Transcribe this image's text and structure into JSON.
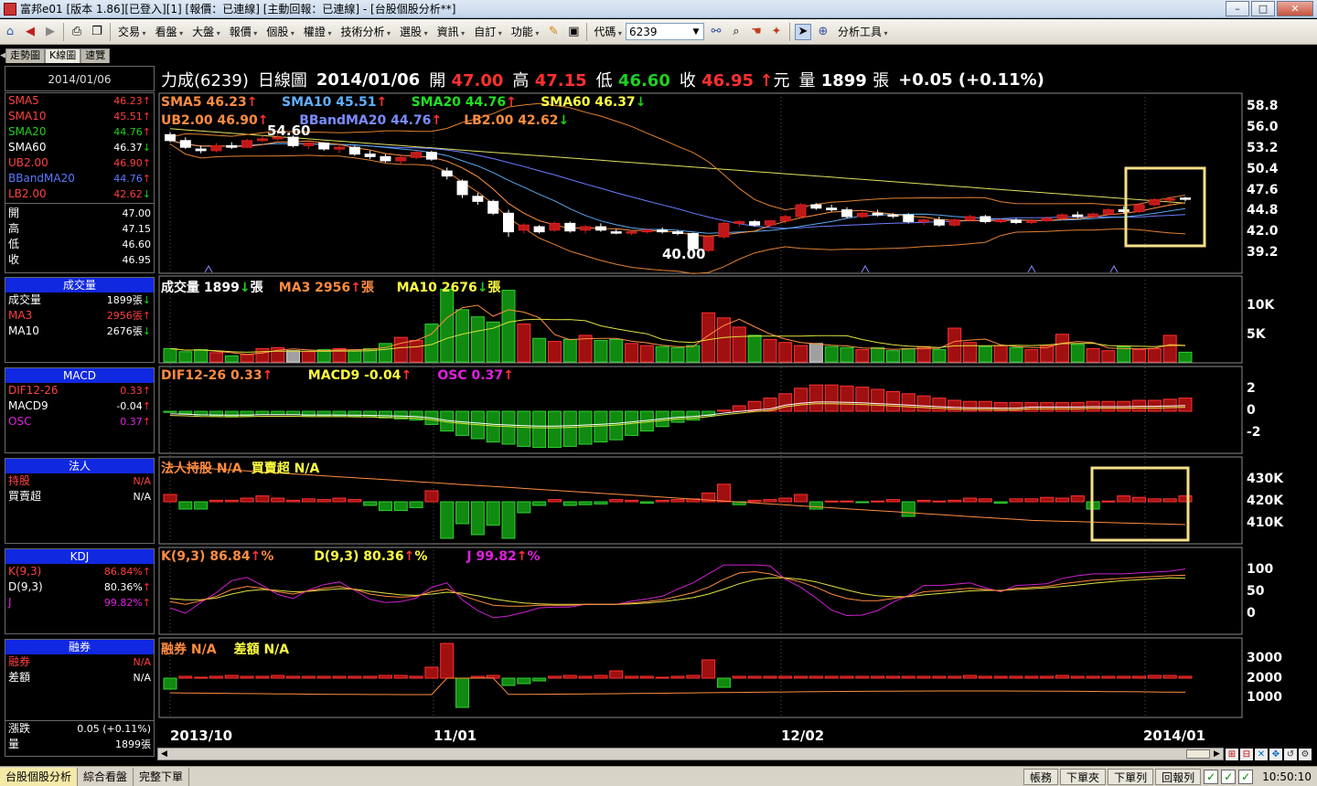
{
  "window": {
    "title": "富邦e01 [版本 1.86][已登入][1] [報價：已連線] [主動回報：已連線] - [台股個股分析**]"
  },
  "menu": {
    "items": [
      "交易",
      "看盤",
      "大盤",
      "報價",
      "個股",
      "權證",
      "技術分析",
      "選股",
      "資訊",
      "自訂",
      "功能"
    ],
    "code_label": "代碼",
    "code_value": "6239",
    "analysis_tools": "分析工具"
  },
  "tabs": [
    "走勢圖",
    "K線圖",
    "速覽"
  ],
  "header": {
    "name": "力成(6239)",
    "period": "日線圖",
    "date": "2014/01/06",
    "open_label": "開",
    "open": "47.00",
    "high_label": "高",
    "high": "47.15",
    "low_label": "低",
    "low": "46.60",
    "close_label": "收",
    "close": "46.95",
    "unit": "元",
    "vol_label": "量",
    "volume": "1899",
    "vol_unit": "張",
    "change": "+0.05 (+0.11%)"
  },
  "side": {
    "date": "2014/01/06",
    "price": [
      {
        "label": "SMA5",
        "value": "46.23",
        "dir": "up",
        "color": "#ff4040"
      },
      {
        "label": "SMA10",
        "value": "45.51",
        "dir": "up",
        "color": "#ff4040"
      },
      {
        "label": "SMA20",
        "value": "44.76",
        "dir": "up",
        "color": "#20d020"
      },
      {
        "label": "SMA60",
        "value": "46.37",
        "dir": "dn",
        "color": "#ffffff"
      },
      {
        "label": "UB2.00",
        "value": "46.90",
        "dir": "up",
        "color": "#ff4040"
      },
      {
        "label": "BBandMA20",
        "value": "44.76",
        "dir": "up",
        "color": "#5a7aff"
      },
      {
        "label": "LB2.00",
        "value": "42.62",
        "dir": "dn",
        "color": "#ff4040"
      }
    ],
    "ohlc": [
      {
        "label": "開",
        "value": "47.00"
      },
      {
        "label": "高",
        "value": "47.15"
      },
      {
        "label": "低",
        "value": "46.60"
      },
      {
        "label": "收",
        "value": "46.95"
      }
    ],
    "vol": {
      "head": "成交量",
      "rows": [
        {
          "label": "成交量",
          "value": "1899張",
          "dir": "dn",
          "color": "#ffffff"
        },
        {
          "label": "MA3",
          "value": "2956張",
          "dir": "up",
          "color": "#ff4040"
        },
        {
          "label": "MA10",
          "value": "2676張",
          "dir": "dn",
          "color": "#ffffff"
        }
      ]
    },
    "macd": {
      "head": "MACD",
      "rows": [
        {
          "label": "DIF12-26",
          "value": "0.33",
          "dir": "up",
          "color": "#ff4040"
        },
        {
          "label": "MACD9",
          "value": "-0.04",
          "dir": "up",
          "color": "#ffffff"
        },
        {
          "label": "OSC",
          "value": "0.37",
          "dir": "up",
          "color": "#e020e0"
        }
      ]
    },
    "inst": {
      "head": "法人",
      "rows": [
        {
          "label": "持股",
          "value": "N/A",
          "dir": "",
          "color": "#ff4040"
        },
        {
          "label": "買賣超",
          "value": "N/A",
          "dir": "",
          "color": "#ffffff"
        }
      ]
    },
    "kdj": {
      "head": "KDJ",
      "rows": [
        {
          "label": "K(9,3)",
          "value": "86.84%",
          "dir": "up",
          "color": "#ff4040"
        },
        {
          "label": "D(9,3)",
          "value": "80.36%",
          "dir": "up",
          "color": "#ffffff"
        },
        {
          "label": "J",
          "value": "99.82%",
          "dir": "up",
          "color": "#e020e0"
        }
      ]
    },
    "margin": {
      "head": "融券",
      "rows": [
        {
          "label": "融券",
          "value": "N/A",
          "dir": "",
          "color": "#ff4040"
        },
        {
          "label": "差額",
          "value": "N/A",
          "dir": "",
          "color": "#ffffff"
        }
      ]
    },
    "summary": [
      {
        "label": "漲跌",
        "value": "0.05 (+0.11%)"
      },
      {
        "label": "量",
        "value": "1899張"
      }
    ]
  },
  "panels": {
    "price": {
      "line1": [
        {
          "text": "SMA5 46.23",
          "dir": "up",
          "color": "#ff8c40"
        },
        {
          "text": "SMA10 45.51",
          "dir": "up",
          "color": "#60b0ff"
        },
        {
          "text": "SMA20 44.76",
          "dir": "up",
          "color": "#20e020"
        },
        {
          "text": "SMA60 46.37",
          "dir": "dn",
          "color": "#ffff40"
        }
      ],
      "line2": [
        {
          "text": "UB2.00 46.90",
          "dir": "up",
          "color": "#ff8c40"
        },
        {
          "text": "BBandMA20 44.76",
          "dir": "up",
          "color": "#7a8cff"
        },
        {
          "text": "LB2.00 42.62",
          "dir": "dn",
          "color": "#ff8c40"
        }
      ],
      "yticks": [
        "58.8",
        "56.0",
        "53.2",
        "50.4",
        "47.6",
        "44.8",
        "42.0",
        "39.2"
      ],
      "hi_label": "54.60",
      "lo_label": "40.00"
    },
    "volume": {
      "items": [
        {
          "text": "成交量 1899",
          "dir": "dn",
          "color": "#ffffff",
          "suffix": "張"
        },
        {
          "text": "MA3 2956",
          "dir": "up",
          "color": "#ff8c40",
          "suffix": "張"
        },
        {
          "text": "MA10 2676",
          "dir": "dn",
          "color": "#ffff40",
          "suffix": "張"
        }
      ],
      "yticks": [
        "10K",
        "5K"
      ]
    },
    "macd": {
      "items": [
        {
          "text": "DIF12-26 0.33",
          "dir": "up",
          "color": "#ff8c40"
        },
        {
          "text": "MACD9 -0.04",
          "dir": "up",
          "color": "#ffff40"
        },
        {
          "text": "OSC 0.37",
          "dir": "up",
          "color": "#e020e0"
        }
      ],
      "yticks": [
        "2",
        "0",
        "-2"
      ]
    },
    "inst": {
      "items": [
        {
          "text": "法人持股 N/A",
          "dir": "",
          "color": "#ff8c40"
        },
        {
          "text": "買賣超 N/A",
          "dir": "",
          "color": "#ffff40"
        }
      ],
      "yticks": [
        "430K",
        "420K",
        "410K"
      ]
    },
    "kdj": {
      "items": [
        {
          "text": "K(9,3) 86.84",
          "dir": "up",
          "color": "#ff8c40",
          "suffix": "%"
        },
        {
          "text": "D(9,3) 80.36",
          "dir": "up",
          "color": "#ffff40",
          "suffix": "%"
        },
        {
          "text": "J 99.82",
          "dir": "up",
          "color": "#e020e0",
          "suffix": "%"
        }
      ],
      "yticks": [
        "100",
        "50",
        "0"
      ]
    },
    "margin": {
      "items": [
        {
          "text": "融券 N/A",
          "dir": "",
          "color": "#ff8c40"
        },
        {
          "text": "差額 N/A",
          "dir": "",
          "color": "#ffff40"
        }
      ],
      "yticks": [
        "3000",
        "2000",
        "1000"
      ]
    }
  },
  "xaxis": [
    "2013/10",
    "11/01",
    "12/02",
    "2014/01"
  ],
  "statusbar": {
    "tabs": [
      "台股個股分析",
      "綜合看盤",
      "完整下單"
    ],
    "buttons": [
      "帳務",
      "下單夾",
      "下單列",
      "回報列"
    ],
    "clock": "10:50:10"
  },
  "chart_data": {
    "type": "candlestick",
    "note_series": "daily bars from 2013/10 to 2014/01/06 (approx. read from chart)",
    "ohlc": [
      [
        54.5,
        54.8,
        53.6,
        53.8
      ],
      [
        53.8,
        54.2,
        52.8,
        53.0
      ],
      [
        52.8,
        53.2,
        52.3,
        52.6
      ],
      [
        52.6,
        53.5,
        52.4,
        53.2
      ],
      [
        53.2,
        53.6,
        52.8,
        53.0
      ],
      [
        53.0,
        54.0,
        52.9,
        53.8
      ],
      [
        53.8,
        54.4,
        53.6,
        54.0
      ],
      [
        54.0,
        54.6,
        53.8,
        54.2
      ],
      [
        54.2,
        54.4,
        53.0,
        53.2
      ],
      [
        53.2,
        53.6,
        52.8,
        53.5
      ],
      [
        53.5,
        53.6,
        52.6,
        52.8
      ],
      [
        52.8,
        53.3,
        52.3,
        53.0
      ],
      [
        53.0,
        53.2,
        52.0,
        52.2
      ],
      [
        52.2,
        52.6,
        51.6,
        51.9
      ],
      [
        51.9,
        52.2,
        51.2,
        51.4
      ],
      [
        51.4,
        52.0,
        51.0,
        51.8
      ],
      [
        51.8,
        52.6,
        51.6,
        52.4
      ],
      [
        52.4,
        52.6,
        51.4,
        51.6
      ],
      [
        50.2,
        50.6,
        49.2,
        49.6
      ],
      [
        49.0,
        49.2,
        47.0,
        47.4
      ],
      [
        47.2,
        47.6,
        46.2,
        46.6
      ],
      [
        46.6,
        46.8,
        45.0,
        45.2
      ],
      [
        45.2,
        45.6,
        42.4,
        43.0
      ],
      [
        43.2,
        44.0,
        42.8,
        43.8
      ],
      [
        43.6,
        43.8,
        42.8,
        43.0
      ],
      [
        43.2,
        44.2,
        43.0,
        44.0
      ],
      [
        44.0,
        44.2,
        42.9,
        43.1
      ],
      [
        43.2,
        43.8,
        42.8,
        43.6
      ],
      [
        43.6,
        44.0,
        43.0,
        43.2
      ],
      [
        43.0,
        43.3,
        42.7,
        42.9
      ],
      [
        42.9,
        43.2,
        42.6,
        43.0
      ],
      [
        43.0,
        43.4,
        42.8,
        43.2
      ],
      [
        43.2,
        43.5,
        42.8,
        43.0
      ],
      [
        43.0,
        43.2,
        42.6,
        42.8
      ],
      [
        42.8,
        42.9,
        40.6,
        41.0
      ],
      [
        40.8,
        42.6,
        40.6,
        42.4
      ],
      [
        42.4,
        44.2,
        42.2,
        44.0
      ],
      [
        44.0,
        44.4,
        43.6,
        44.2
      ],
      [
        44.2,
        44.4,
        43.6,
        43.8
      ],
      [
        43.8,
        44.4,
        43.6,
        44.3
      ],
      [
        44.3,
        45.0,
        44.0,
        44.8
      ],
      [
        44.8,
        46.4,
        44.6,
        46.2
      ],
      [
        46.2,
        46.4,
        45.6,
        45.8
      ],
      [
        45.8,
        46.2,
        45.4,
        45.6
      ],
      [
        45.6,
        45.9,
        44.6,
        44.8
      ],
      [
        44.8,
        45.4,
        44.6,
        45.2
      ],
      [
        45.2,
        45.6,
        44.8,
        45.0
      ],
      [
        45.0,
        45.2,
        44.6,
        44.9
      ],
      [
        45.0,
        45.2,
        44.0,
        44.2
      ],
      [
        44.2,
        44.6,
        43.8,
        44.4
      ],
      [
        44.4,
        44.8,
        43.6,
        43.8
      ],
      [
        43.8,
        44.6,
        43.6,
        44.4
      ],
      [
        44.4,
        45.0,
        44.2,
        44.8
      ],
      [
        44.8,
        45.0,
        44.0,
        44.2
      ],
      [
        44.2,
        44.6,
        44.0,
        44.4
      ],
      [
        44.4,
        44.6,
        43.9,
        44.1
      ],
      [
        44.1,
        44.5,
        43.9,
        44.3
      ],
      [
        44.3,
        44.8,
        44.2,
        44.6
      ],
      [
        44.6,
        45.2,
        44.4,
        45.0
      ],
      [
        45.0,
        45.4,
        44.6,
        44.8
      ],
      [
        44.8,
        45.3,
        44.6,
        45.1
      ],
      [
        45.1,
        45.8,
        45.0,
        45.6
      ],
      [
        45.6,
        46.0,
        45.2,
        45.4
      ],
      [
        45.4,
        46.4,
        45.2,
        46.2
      ],
      [
        46.2,
        47.0,
        46.0,
        46.8
      ],
      [
        46.8,
        47.2,
        46.2,
        46.9
      ],
      [
        47.0,
        47.15,
        46.6,
        46.95
      ]
    ],
    "volume_k": [
      2.6,
      2.0,
      2.4,
      1.8,
      1.2,
      1.4,
      2.6,
      2.8,
      2.2,
      2.0,
      2.4,
      2.6,
      2.2,
      2.6,
      3.6,
      4.8,
      4.2,
      7.4,
      14.2,
      10.2,
      8.8,
      7.8,
      14.0,
      7.4,
      4.6,
      4.0,
      4.4,
      5.2,
      4.2,
      4.4,
      3.6,
      3.2,
      3.0,
      2.8,
      3.2,
      9.6,
      8.6,
      6.8,
      5.2,
      4.4,
      3.8,
      3.2,
      3.6,
      3.0,
      2.8,
      2.4,
      2.8,
      2.2,
      2.6,
      3.0,
      2.4,
      6.6,
      3.8,
      3.0,
      3.2,
      2.8,
      2.4,
      3.2,
      5.4,
      3.4,
      2.6,
      2.2,
      3.0,
      2.4,
      2.6,
      5.2,
      1.9
    ],
    "macd_osc": [
      -0.1,
      -0.2,
      -0.35,
      -0.4,
      -0.45,
      -0.4,
      -0.3,
      -0.3,
      -0.3,
      -0.4,
      -0.4,
      -0.4,
      -0.45,
      -0.5,
      -0.6,
      -0.7,
      -0.8,
      -1.2,
      -1.8,
      -2.2,
      -2.5,
      -2.8,
      -3.0,
      -3.2,
      -3.3,
      -3.3,
      -3.2,
      -3.0,
      -2.8,
      -2.6,
      -2.2,
      -1.8,
      -1.4,
      -1.0,
      -0.8,
      -0.4,
      0.1,
      0.5,
      0.9,
      1.2,
      1.6,
      2.1,
      2.4,
      2.4,
      2.3,
      2.2,
      2.0,
      1.8,
      1.6,
      1.4,
      1.2,
      1.0,
      0.9,
      0.9,
      0.8,
      0.8,
      0.8,
      0.8,
      0.8,
      0.8,
      0.9,
      0.9,
      0.9,
      1.0,
      1.0,
      1.1,
      1.2
    ],
    "kdj": {
      "K": [
        28,
        22,
        30,
        40,
        55,
        62,
        58,
        50,
        45,
        52,
        58,
        62,
        55,
        45,
        40,
        38,
        40,
        50,
        56,
        42,
        30,
        20,
        18,
        18,
        20,
        20,
        20,
        22,
        22,
        22,
        25,
        28,
        32,
        40,
        48,
        60,
        78,
        92,
        95,
        90,
        80,
        72,
        60,
        45,
        35,
        30,
        30,
        35,
        40,
        50,
        52,
        55,
        58,
        55,
        52,
        58,
        60,
        62,
        68,
        72,
        76,
        78,
        80,
        82,
        84,
        86,
        87
      ],
      "D": [
        35,
        32,
        32,
        36,
        45,
        52,
        55,
        53,
        50,
        51,
        54,
        57,
        56,
        51,
        47,
        43,
        42,
        45,
        49,
        47,
        41,
        34,
        29,
        25,
        23,
        22,
        22,
        22,
        22,
        22,
        23,
        25,
        28,
        32,
        37,
        45,
        56,
        68,
        77,
        81,
        81,
        78,
        72,
        63,
        54,
        46,
        41,
        39,
        39,
        43,
        46,
        49,
        52,
        53,
        53,
        55,
        57,
        59,
        62,
        65,
        69,
        72,
        75,
        77,
        79,
        81,
        80
      ]
    }
  }
}
